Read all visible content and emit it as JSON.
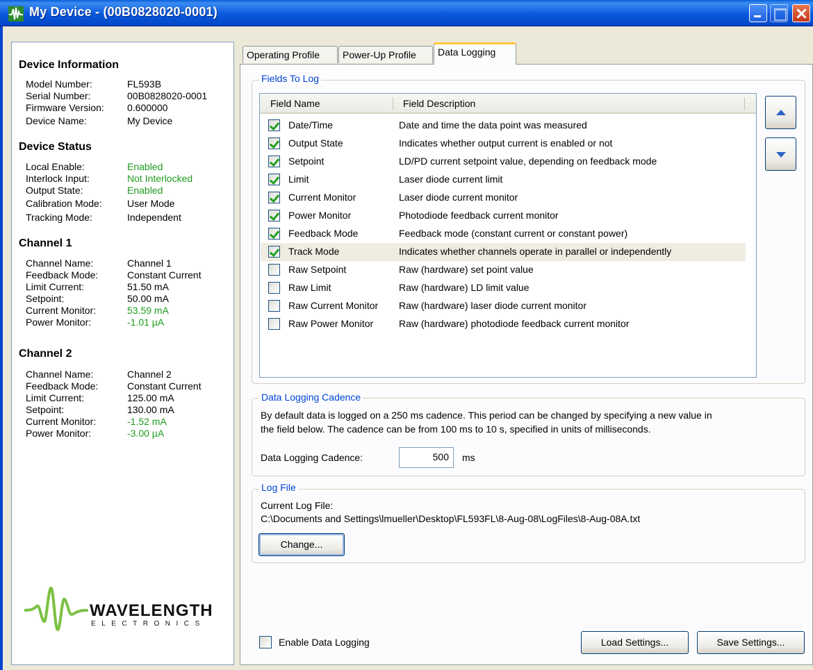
{
  "window": {
    "title": "My Device - (00B0828020-0001)"
  },
  "left": {
    "device_info": {
      "heading": "Device Information",
      "rows": [
        {
          "label": "Model Number:",
          "value": "FL593B"
        },
        {
          "label": "Serial Number:",
          "value": "00B0828020-0001"
        },
        {
          "label": "Firmware Version:",
          "value": "0.600000"
        },
        {
          "label": "Device Name:",
          "value": "My Device"
        }
      ]
    },
    "device_status": {
      "heading": "Device Status",
      "rows": [
        {
          "label": "Local Enable:",
          "value": "Enabled"
        },
        {
          "label": "Interlock Input:",
          "value": "Not Interlocked"
        },
        {
          "label": "Output State:",
          "value": "Enabled"
        },
        {
          "label": "Calibration Mode:",
          "value": "User Mode"
        },
        {
          "label": "Tracking Mode:",
          "value": "Independent"
        }
      ]
    },
    "channel1": {
      "heading": "Channel 1",
      "rows": [
        {
          "label": "Channel Name:",
          "value": "Channel 1"
        },
        {
          "label": "Feedback Mode:",
          "value": "Constant Current"
        },
        {
          "label": "Limit Current:",
          "value": "51.50 mA"
        },
        {
          "label": "Setpoint:",
          "value": "50.00 mA"
        },
        {
          "label": "Current Monitor:",
          "value": "53.59 mA"
        },
        {
          "label": "Power Monitor:",
          "value": "-1.01 µA"
        }
      ]
    },
    "channel2": {
      "heading": "Channel 2",
      "rows": [
        {
          "label": "Channel Name:",
          "value": "Channel 2"
        },
        {
          "label": "Feedback Mode:",
          "value": "Constant Current"
        },
        {
          "label": "Limit Current:",
          "value": "125.00 mA"
        },
        {
          "label": "Setpoint:",
          "value": "130.00 mA"
        },
        {
          "label": "Current Monitor:",
          "value": "-1.52 mA"
        },
        {
          "label": "Power Monitor:",
          "value": "-3.00 µA"
        }
      ]
    },
    "logo": {
      "name": "WAVELENGTH",
      "sub": "ELECTRONICS",
      "color": "#7bc143"
    }
  },
  "tabs": [
    "Operating Profile",
    "Power-Up Profile",
    "Data Logging"
  ],
  "fields_group": {
    "title": "Fields To Log",
    "col_name": "Field Name",
    "col_desc": "Field Description",
    "rows": [
      {
        "name": "Date/Time",
        "desc": "Date and time the data point was measured",
        "checked": true
      },
      {
        "name": "Output State",
        "desc": "Indicates whether output current is enabled or not",
        "checked": true
      },
      {
        "name": "Setpoint",
        "desc": "LD/PD current setpoint value, depending on feedback mode",
        "checked": true
      },
      {
        "name": "Limit",
        "desc": "Laser diode current limit",
        "checked": true
      },
      {
        "name": "Current Monitor",
        "desc": "Laser diode current monitor",
        "checked": true
      },
      {
        "name": "Power Monitor",
        "desc": "Photodiode feedback current monitor",
        "checked": true
      },
      {
        "name": "Feedback Mode",
        "desc": "Feedback mode (constant current or constant power)",
        "checked": true
      },
      {
        "name": "Track Mode",
        "desc": "Indicates whether channels operate in parallel or independently",
        "checked": true
      },
      {
        "name": "Raw Setpoint",
        "desc": "Raw (hardware) set point value",
        "checked": false
      },
      {
        "name": "Raw Limit",
        "desc": "Raw (hardware) LD limit value",
        "checked": false
      },
      {
        "name": "Raw Current Monitor",
        "desc": "Raw (hardware) laser diode current monitor",
        "checked": false
      },
      {
        "name": "Raw Power Monitor",
        "desc": "Raw (hardware) photodiode feedback current monitor",
        "checked": false
      }
    ]
  },
  "cadence_group": {
    "title": "Data Logging Cadence",
    "text1": "By default data is logged on a 250 ms cadence.  This period can be changed by specifying a new value in",
    "text2": "the field below.  The cadence can be from 100 ms to 10 s, specified in units of milliseconds.",
    "label": "Data Logging Cadence:",
    "value": "500",
    "unit": "ms"
  },
  "logfile_group": {
    "title": "Log File",
    "label": "Current Log File:",
    "path": "C:\\Documents and Settings\\lmueller\\Desktop\\FL593FL\\8-Aug-08\\LogFiles\\8-Aug-08A.txt",
    "change_button": "Change..."
  },
  "footer": {
    "enable_label": "Enable Data Logging",
    "load_button": "Load Settings...",
    "save_button": "Save Settings..."
  }
}
